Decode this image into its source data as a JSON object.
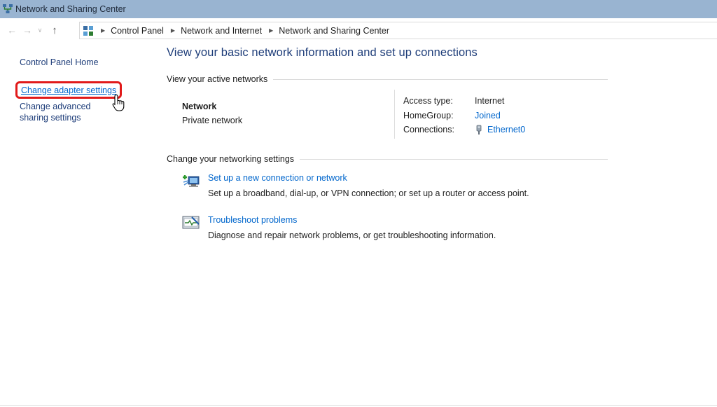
{
  "window": {
    "title": "Network and Sharing Center",
    "icon": "network-center-icon"
  },
  "address_bar": {
    "icon": "control-panel-icon",
    "breadcrumbs": [
      "Control Panel",
      "Network and Internet",
      "Network and Sharing Center"
    ]
  },
  "left_panel": {
    "home": "Control Panel Home",
    "adapter": "Change adapter settings",
    "advanced": "Change advanced sharing settings"
  },
  "main": {
    "title": "View your basic network information and set up connections",
    "active_networks_heading": "View your active networks",
    "network": {
      "name": "Network",
      "category": "Private network"
    },
    "properties": [
      {
        "label": "Access type:",
        "value": "Internet"
      },
      {
        "label": "HomeGroup:",
        "value": "Joined"
      },
      {
        "label": "Connections:",
        "value": "Ethernet0"
      }
    ],
    "settings_heading": "Change your networking settings",
    "tasks": [
      {
        "icon": "new-connection-icon",
        "link": "Set up a new connection or network",
        "desc": "Set up a broadband, dial-up, or VPN connection; or set up a router or access point."
      },
      {
        "icon": "troubleshoot-icon",
        "link": "Troubleshoot problems",
        "desc": "Diagnose and repair network problems, or get troubleshooting information."
      }
    ]
  },
  "colors": {
    "titlebar": "#99b4d1",
    "link": "#0066cc",
    "heading": "#1e3d79",
    "highlight": "#e11a1a"
  }
}
